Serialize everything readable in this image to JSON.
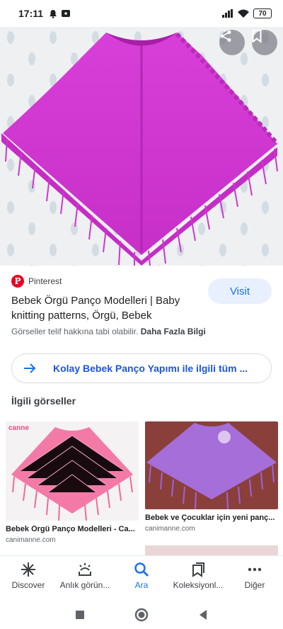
{
  "status_bar": {
    "time": "17:11",
    "battery": "70"
  },
  "hero": {
    "share_icon": "share-icon",
    "bookmark_icon": "bookmark-icon"
  },
  "source": {
    "name": "Pinterest",
    "logo_letter": "P"
  },
  "visit_label": "Visit",
  "title": "Bebek Örgü Panço Modelleri | Baby knitting patterns, Örgü, Bebek",
  "copyright": {
    "text": "Görseller telif hakkına tabi olabilir.",
    "more": "Daha Fazla Bilgi"
  },
  "related_search": "Kolay Bebek Panço Yapımı ile ilgili tüm ...",
  "section_title": "İlgili görseller",
  "related": [
    {
      "title": "Bebek Örgü Panço Modelleri - Ca...",
      "site": "canimanne.com",
      "watermark": "canne"
    },
    {
      "title": "Bebek ve Çocuklar için yeni panç...",
      "site": "canimanne.com"
    }
  ],
  "bottom_nav": [
    {
      "label": "Discover",
      "icon": "discover-icon"
    },
    {
      "label": "Anlık görün...",
      "icon": "snapshot-icon"
    },
    {
      "label": "Ara",
      "icon": "search-icon"
    },
    {
      "label": "Koleksiyonl...",
      "icon": "collections-icon"
    },
    {
      "label": "Diğer",
      "icon": "more-icon"
    }
  ],
  "colors": {
    "accent": "#1a73e8",
    "pinterest": "#e60023",
    "poncho_main": "#d63ad8",
    "poncho_pink": "#f279a8",
    "poncho_purple": "#a86fdc"
  }
}
